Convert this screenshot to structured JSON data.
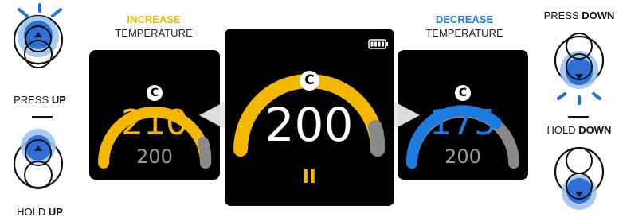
{
  "left_controls": {
    "press_up_prefix": "PRESS ",
    "press_up_bold": "UP",
    "hold_up_prefix": "HOLD ",
    "hold_up_bold": "UP"
  },
  "right_controls": {
    "press_down_prefix": "PRESS ",
    "press_down_bold": "DOWN",
    "hold_down_prefix": "HOLD ",
    "hold_down_bold": "DOWN"
  },
  "increase_heading": {
    "line1": "INCREASE",
    "line2": "TEMPERATURE",
    "color": "#f5b800"
  },
  "decrease_heading": {
    "line1": "DECREASE",
    "line2": "TEMPERATURE",
    "color": "#1e7be0"
  },
  "left_display": {
    "unit": "C",
    "target": "210",
    "current": "200",
    "arc_color": "#f5b800",
    "target_color": "#f5b800"
  },
  "center_display": {
    "unit": "C",
    "value": "200",
    "status": "II",
    "arc_color": "#f5b800"
  },
  "right_display": {
    "unit": "C",
    "target": "175",
    "current": "200",
    "arc_color": "#1e7be0",
    "target_color": "#1e7be0"
  },
  "colors": {
    "blue_accent": "#2f6fd6",
    "light_blue": "#9ec3ee",
    "gray_arc": "#8a8a8a"
  }
}
